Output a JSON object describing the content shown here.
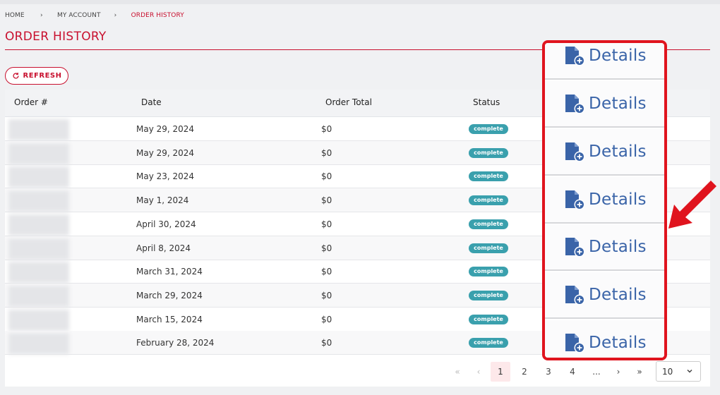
{
  "breadcrumb": {
    "home": "HOME",
    "separator": "›",
    "account": "MY ACCOUNT",
    "current": "ORDER HISTORY"
  },
  "page_title": "ORDER HISTORY",
  "refresh_label": "REFRESH",
  "table": {
    "headers": {
      "order": "Order #",
      "date": "Date",
      "total": "Order Total",
      "status": "Status"
    },
    "rows": [
      {
        "date": "May 29, 2024",
        "total": "$0",
        "status": "complete"
      },
      {
        "date": "May 29, 2024",
        "total": "$0",
        "status": "complete"
      },
      {
        "date": "May 23, 2024",
        "total": "$0",
        "status": "complete"
      },
      {
        "date": "May 1, 2024",
        "total": "$0",
        "status": "complete"
      },
      {
        "date": "April 30, 2024",
        "total": "$0",
        "status": "complete"
      },
      {
        "date": "April 8, 2024",
        "total": "$0",
        "status": "complete"
      },
      {
        "date": "March 31, 2024",
        "total": "$0",
        "status": "complete"
      },
      {
        "date": "March 29, 2024",
        "total": "$0",
        "status": "complete"
      },
      {
        "date": "March 15, 2024",
        "total": "$0",
        "status": "complete"
      },
      {
        "date": "February 28, 2024",
        "total": "$0",
        "status": "complete"
      }
    ]
  },
  "details_label": "Details",
  "pagination": {
    "first": "«",
    "prev": "‹",
    "pages": [
      "1",
      "2",
      "3",
      "4"
    ],
    "ellipsis": "...",
    "next": "›",
    "last": "»",
    "current_page": "1",
    "per_page": "10"
  },
  "colors": {
    "accent": "#c8102e",
    "badge": "#3aa0ad",
    "highlight": "#e0141e",
    "details": "#3a64a8"
  }
}
